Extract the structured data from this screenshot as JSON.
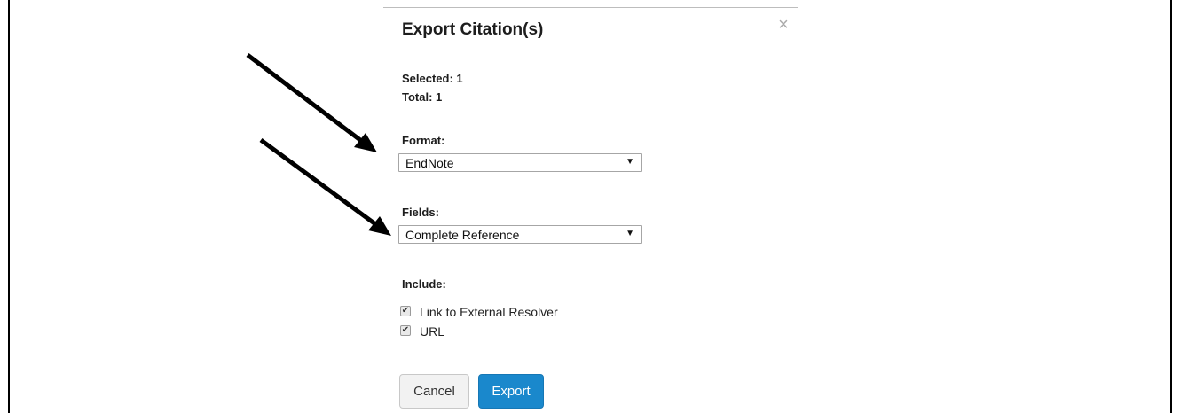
{
  "modal": {
    "title": "Export Citation(s)",
    "close_icon": "×",
    "selected_text": "Selected: 1",
    "total_text": "Total: 1"
  },
  "format": {
    "label": "Format:",
    "selected": "EndNote"
  },
  "fields": {
    "label": "Fields:",
    "selected": "Complete Reference"
  },
  "include": {
    "label": "Include:",
    "options": [
      {
        "label": "Link to External Resolver",
        "checked": true
      },
      {
        "label": "URL",
        "checked": true
      }
    ]
  },
  "buttons": {
    "cancel_label": "Cancel",
    "export_label": "Export"
  },
  "icons": {
    "dropdown_arrow": "▼",
    "checkmark": "✔"
  },
  "colors": {
    "primary": "#1a88cc",
    "annotation_arrow": "#000000"
  }
}
